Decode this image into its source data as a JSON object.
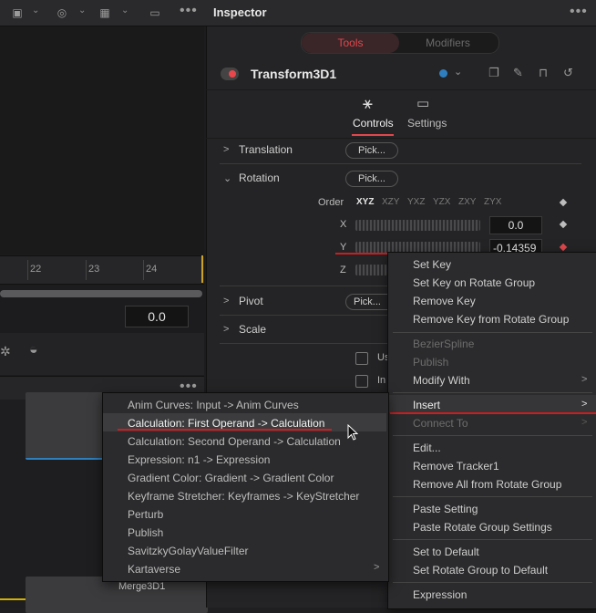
{
  "inspector": {
    "title": "Inspector",
    "tabs": {
      "tools": "Tools",
      "modifiers": "Modifiers"
    },
    "node_name": "Transform3D1",
    "control_tabs": {
      "controls": "Controls",
      "settings": "Settings"
    },
    "sections": {
      "translation": "Translation",
      "rotation": "Rotation",
      "pivot": "Pivot",
      "scale": "Scale"
    },
    "pick_label": "Pick...",
    "order": {
      "label": "Order",
      "options": [
        "XYZ",
        "XZY",
        "YXZ",
        "YZX",
        "ZXY",
        "ZYX"
      ]
    },
    "axes": {
      "x": "X",
      "y": "Y",
      "z": "Z"
    },
    "values": {
      "x": "0.0",
      "y": "-0.14359"
    },
    "checkbox_labels": {
      "first": "Us",
      "second": "In"
    }
  },
  "timeline": {
    "ticks": [
      "22",
      "23",
      "24"
    ],
    "time_value": "0.0"
  },
  "nodes": {
    "merge": "Merge3D1"
  },
  "context_menu": {
    "set_key": "Set Key",
    "set_key_group": "Set Key on Rotate Group",
    "remove_key": "Remove Key",
    "remove_key_group": "Remove Key from Rotate Group",
    "bezier": "BezierSpline",
    "publish": "Publish",
    "modify_with": "Modify With",
    "insert": "Insert",
    "connect_to": "Connect To",
    "edit": "Edit...",
    "remove_tracker": "Remove Tracker1",
    "remove_all": "Remove All from Rotate Group",
    "paste_setting": "Paste Setting",
    "paste_group": "Paste Rotate Group Settings",
    "set_default": "Set to Default",
    "set_group_default": "Set Rotate Group to Default",
    "expression": "Expression"
  },
  "insert_submenu": [
    "Anim Curves: Input -> Anim Curves",
    "Calculation: First Operand -> Calculation",
    "Calculation: Second Operand -> Calculation",
    "Expression: n1 -> Expression",
    "Gradient Color: Gradient -> Gradient Color",
    "Keyframe Stretcher: Keyframes -> KeyStretcher",
    "Perturb",
    "Publish",
    "SavitzkyGolayValueFilter",
    "Kartaverse"
  ],
  "colors": {
    "accent_red": "#e0474c",
    "highlight_line": "#cc1d21",
    "node_blue": "#2f7fbf",
    "playhead": "#c9a227"
  }
}
